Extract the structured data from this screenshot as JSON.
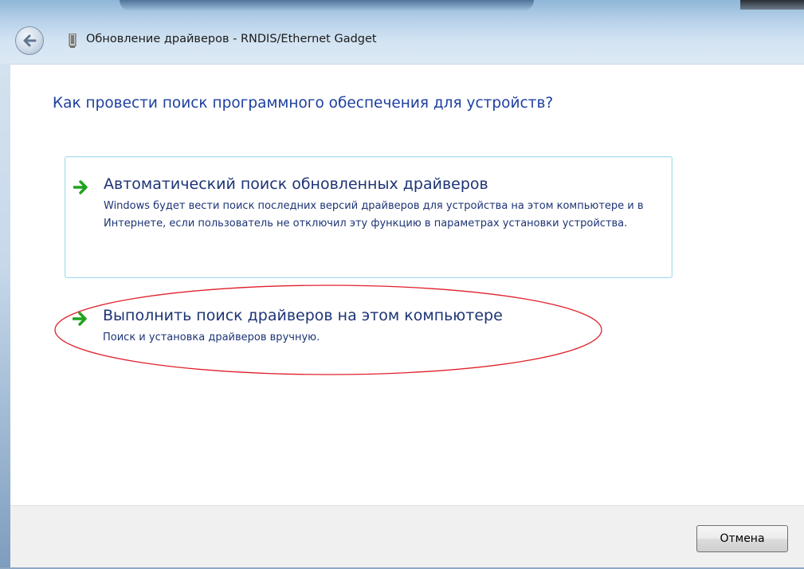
{
  "window": {
    "title": "Обновление драйверов - RNDIS/Ethernet Gadget"
  },
  "icons": {
    "back": "back-arrow-icon",
    "device": "device-icon",
    "option_arrow": "green-arrow-icon"
  },
  "main": {
    "question": "Как провести поиск программного обеспечения для устройств?",
    "options": [
      {
        "title": "Автоматический поиск обновленных драйверов",
        "description": "Windows будет вести поиск последних версий драйверов для устройства на этом компьютере и в Интернете, если пользователь не отключил эту функцию в параметрах установки устройства."
      },
      {
        "title": "Выполнить поиск драйверов на этом компьютере",
        "description": "Поиск и установка драйверов вручную."
      }
    ]
  },
  "footer": {
    "cancel_label": "Отмена"
  },
  "colors": {
    "heading": "#1d3f9f",
    "option_text": "#1d3475",
    "option_border": "#a7dcec",
    "arrow": "#1ea31e",
    "annotation_ellipse": "#e0202a"
  }
}
